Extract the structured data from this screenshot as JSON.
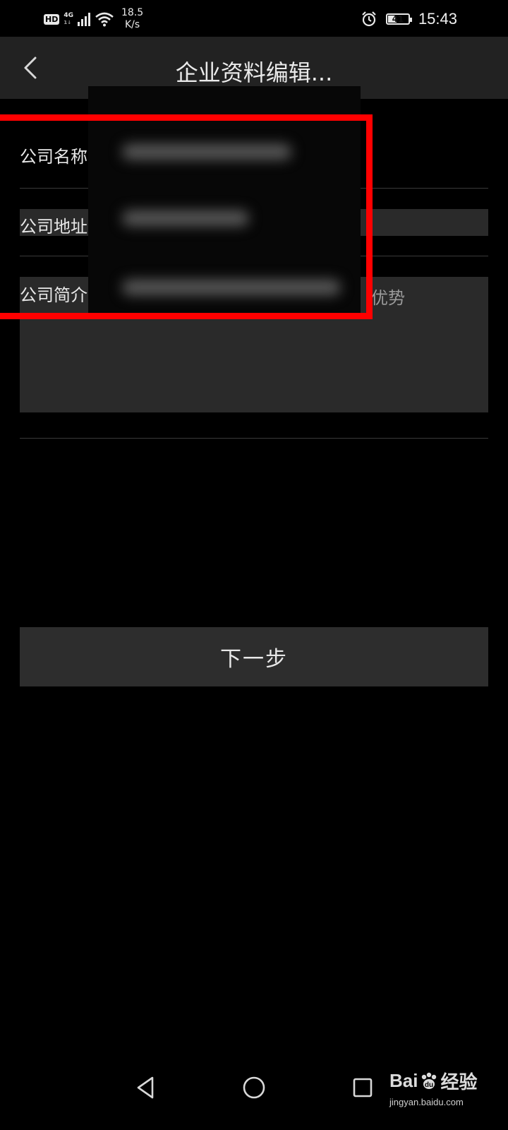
{
  "status_bar": {
    "hd": "HD",
    "network": "4G",
    "network_sub": "1↓",
    "speed_value": "18.5",
    "speed_unit": "K/s",
    "battery": "41",
    "time": "15:43"
  },
  "header": {
    "title": "企业资料编辑..."
  },
  "form": {
    "company_name_label": "公司名称",
    "company_address_label": "公司地址",
    "company_intro_label": "公司简介",
    "intro_hint_visible": "势、优势"
  },
  "actions": {
    "next_label": "下一步"
  },
  "watermark": {
    "brand_left": "Bai",
    "brand_right": "经验",
    "url": "jingyan.baidu.com"
  },
  "colors": {
    "highlight": "#ff0000",
    "titlebar_bg": "#222222",
    "button_bg": "#2d2d2d"
  },
  "icons": {
    "back": "chevron-left-icon",
    "alarm": "alarm-icon",
    "wifi": "wifi-icon",
    "nav_back": "triangle-back-icon",
    "nav_home": "circle-home-icon",
    "nav_recent": "square-recent-icon"
  }
}
